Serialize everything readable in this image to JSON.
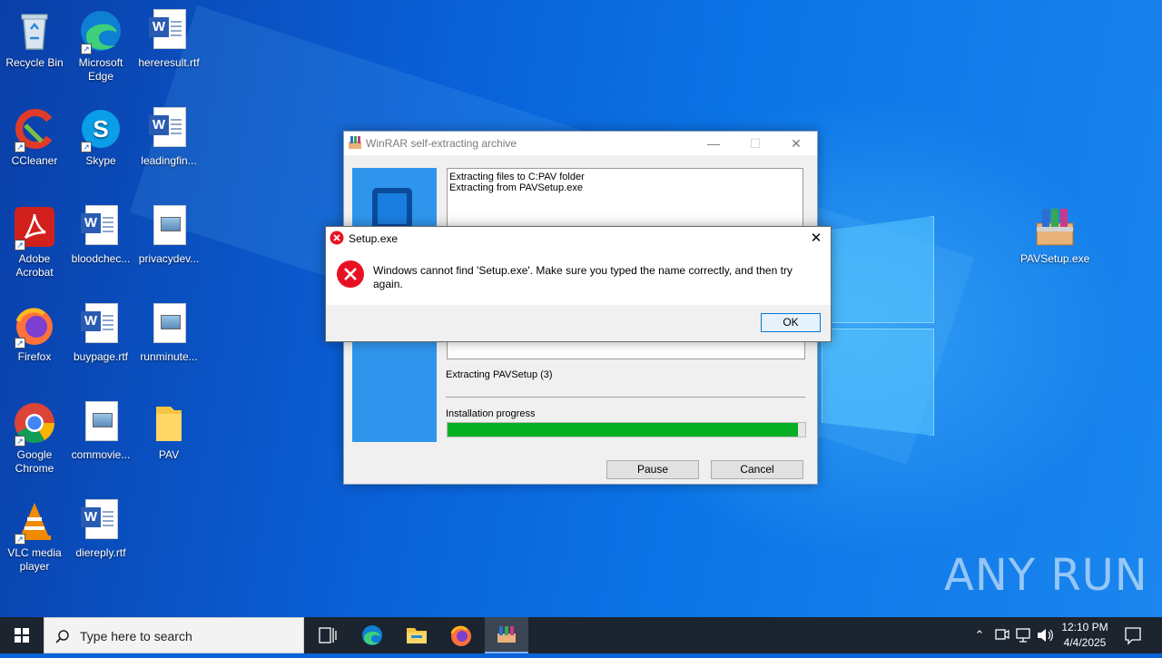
{
  "desktop": {
    "icons": [
      {
        "label": "Recycle Bin",
        "icon": "recycle-bin-icon"
      },
      {
        "label": "Microsoft Edge",
        "icon": "edge-icon"
      },
      {
        "label": "hereresult.rtf",
        "icon": "word-doc-icon"
      },
      {
        "label": "CCleaner",
        "icon": "ccleaner-icon"
      },
      {
        "label": "Skype",
        "icon": "skype-icon"
      },
      {
        "label": "leadingfin...",
        "icon": "word-doc-icon"
      },
      {
        "label": "Adobe Acrobat",
        "icon": "acrobat-icon"
      },
      {
        "label": "bloodchec...",
        "icon": "word-doc-icon"
      },
      {
        "label": "privacydev...",
        "icon": "image-file-icon"
      },
      {
        "label": "Firefox",
        "icon": "firefox-icon"
      },
      {
        "label": "buypage.rtf",
        "icon": "word-doc-icon"
      },
      {
        "label": "runminute...",
        "icon": "image-file-icon"
      },
      {
        "label": "Google Chrome",
        "icon": "chrome-icon"
      },
      {
        "label": "commovie...",
        "icon": "image-file-icon"
      },
      {
        "label": "PAV",
        "icon": "folder-icon"
      },
      {
        "label": "VLC media player",
        "icon": "vlc-icon"
      },
      {
        "label": "diereply.rtf",
        "icon": "word-doc-icon"
      },
      {
        "label": "PAVSetup.exe",
        "icon": "winrar-icon"
      }
    ]
  },
  "winrar": {
    "title": "WinRAR self-extracting archive",
    "log_lines": [
      "Extracting files to C:PAV folder",
      "Extracting from PAVSetup.exe"
    ],
    "status": "Extracting PAVSetup (3)",
    "progress_label": "Installation progress",
    "progress": 0.98,
    "pause_label": "Pause",
    "cancel_label": "Cancel"
  },
  "error_dialog": {
    "title": "Setup.exe",
    "message": "Windows cannot find 'Setup.exe'. Make sure you typed the name correctly, and then try again.",
    "ok_label": "OK"
  },
  "taskbar": {
    "search_placeholder": "Type here to search",
    "time": "12:10 PM",
    "date": "4/4/2025"
  },
  "watermark": "ANY RUN",
  "colors": {
    "progress": "#06b025",
    "error": "#e81123",
    "desktop": "#0a63d8"
  }
}
